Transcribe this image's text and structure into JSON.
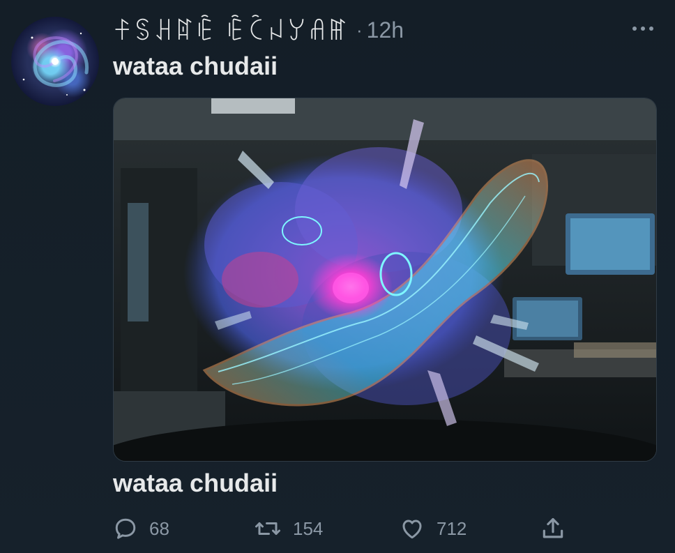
{
  "author": {
    "display_name": "ꊰꌗꃅꍏꍟ ꍟꉓꈤꌦꋬꂵ",
    "separator": "·",
    "timestamp": "12h",
    "avatar_icon": "galaxy-avatar"
  },
  "tweet": {
    "text": "wataa chudaii",
    "media_alt": "glowing cosmic cloud with crystal shards in a sci-fi room",
    "caption": "wataa chudaii"
  },
  "actions": {
    "reply": {
      "icon": "reply-icon",
      "count": "68"
    },
    "retweet": {
      "icon": "retweet-icon",
      "count": "154"
    },
    "like": {
      "icon": "heart-icon",
      "count": "712"
    },
    "share": {
      "icon": "share-icon"
    }
  },
  "colors": {
    "background": "#15202b",
    "text": "#e7e9ea",
    "muted": "#8b98a5"
  }
}
